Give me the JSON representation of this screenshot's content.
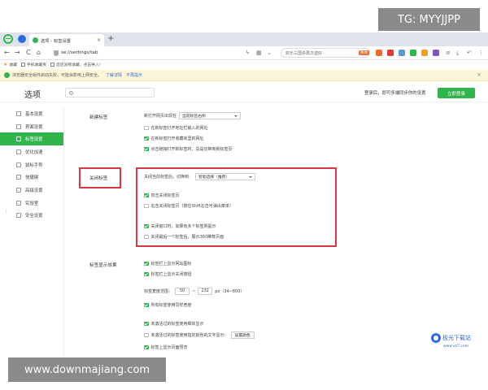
{
  "watermarks": {
    "top": "TG: MYYJJPP",
    "bottom": "www.downmajiang.com"
  },
  "tabbar": {
    "tab_title": "选项 - 标签设置",
    "tab_close": "×",
    "new_tab": "+"
  },
  "addrbar": {
    "back": "←",
    "forward": "→",
    "reload": "C",
    "home": "⌂",
    "url": "se://settings/tab",
    "search_text": "欢乐三国杀再次送好",
    "search_badge": "绝体",
    "extension_colors": [
      "#f36b2c",
      "#e53935",
      "#5b9bd5",
      "#2fb54c",
      "#f0a020",
      "#7e57c2"
    ],
    "menu": "≡",
    "download": "⤓",
    "undo": "↶",
    "more": "⋮"
  },
  "bookmarks": [
    {
      "label": "收藏",
      "icon": "star-icon"
    },
    {
      "label": "手机收藏夹",
      "icon": "phone-icon"
    },
    {
      "label": "您还没有收藏，点击导入！",
      "icon": "folder-icon"
    }
  ],
  "notice": {
    "text": "浏览器安全组件启动失败，可能会影响上网安全。",
    "link1": "了解详情",
    "link2": "不再提示",
    "close": "×"
  },
  "header": {
    "title": "选项",
    "login_hint": "登录后，即可多端同步你的设置",
    "login_button": "立即登录"
  },
  "sidebar": {
    "items": [
      {
        "label": "基本设置",
        "active": false
      },
      {
        "label": "界面设置",
        "active": false
      },
      {
        "label": "标签设置",
        "active": true
      },
      {
        "label": "优化加速",
        "active": false
      },
      {
        "label": "鼠标手势",
        "active": false
      },
      {
        "label": "快捷键",
        "active": false
      },
      {
        "label": "高级设置",
        "active": false
      },
      {
        "label": "实验室",
        "active": false
      },
      {
        "label": "安全设置",
        "active": false
      }
    ]
  },
  "new_tab": {
    "label": "新建标签",
    "open_position_label": "新打开网页出现在",
    "open_position_value": "当前标签右侧",
    "options": [
      {
        "label": "在新标签打开地址栏输入的网址",
        "checked": false
      },
      {
        "label": "在新标签打开收藏夹里的网址",
        "checked": true
      },
      {
        "label": "点击链接打开新标签时，总是切换到新标签页",
        "checked": true
      }
    ]
  },
  "close_tab": {
    "label": "关闭标签",
    "switch_label": "关闭当前标签后，切换到：",
    "switch_value": "智能选择（推荐）",
    "options": [
      {
        "label": "双击关闭标签页",
        "checked": true
      },
      {
        "label": "右击关闭标签页（按住Shift右击可弹出菜单）",
        "checked": false
      },
      {
        "label": "关闭窗口时，如果有多个标签则提示",
        "checked": true
      },
      {
        "label": "关闭最后一个标签后，展示360推荐页面",
        "checked": false
      }
    ]
  },
  "tab_display": {
    "label": "标签显示效果",
    "options_a": [
      {
        "label": "标签栏上显示网站图标",
        "checked": true
      },
      {
        "label": "标签栏上显示关闭按钮",
        "checked": true
      }
    ],
    "width_label": "标签宽度范围：",
    "width_min": "50",
    "width_sep": "~",
    "width_max": "232",
    "width_unit": "px（34~800）",
    "options_b": [
      {
        "label": "所有标签使用同样宽度",
        "checked": true
      }
    ],
    "options_c": [
      {
        "label": "未激活过的标签使用细体显示",
        "checked": true
      },
      {
        "label": "未激活过的标签使用指定颜色的文字显示：",
        "checked": false
      },
      {
        "label": "标签上显示页面预览",
        "checked": true
      }
    ],
    "color_button": "设置颜色"
  },
  "brand": {
    "name": "极光下载站",
    "url": "www.xz7.com"
  },
  "edge_mark": "⋮",
  "colors": {
    "accent": "#2fb54c",
    "highlight": "#d9363e",
    "link": "#2d6bd8"
  }
}
